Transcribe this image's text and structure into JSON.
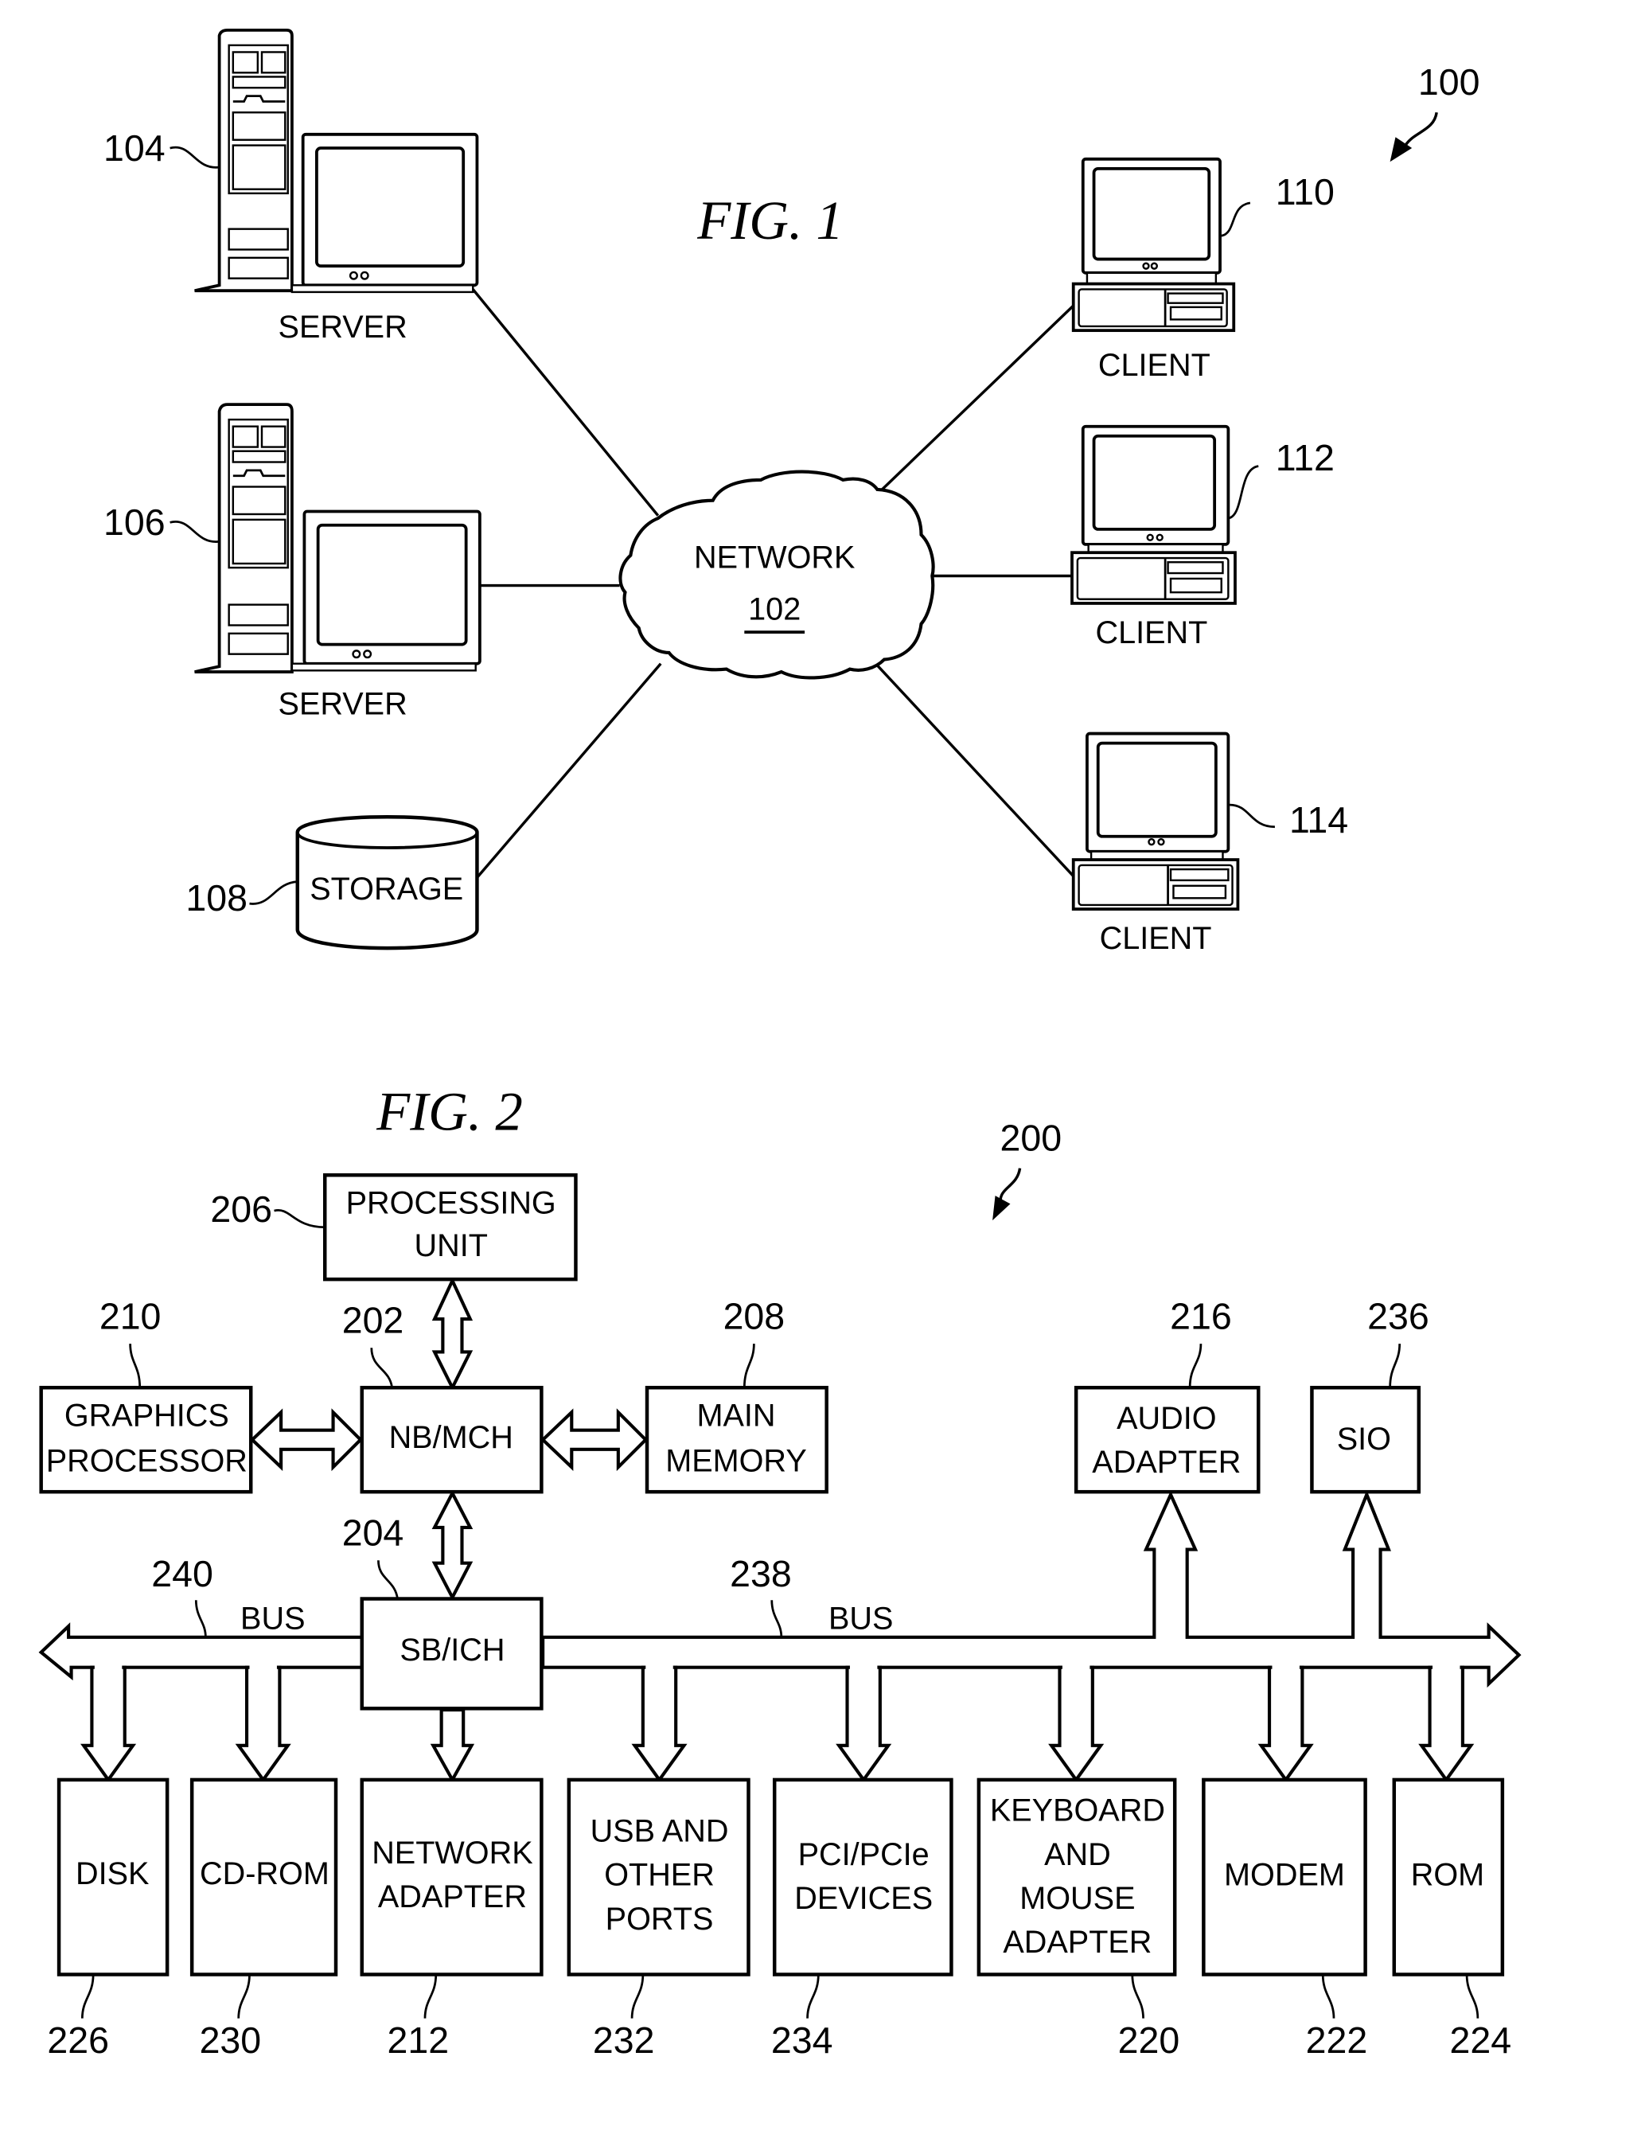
{
  "figure1": {
    "title": "FIG. 1",
    "ref": "100",
    "network": {
      "label": "NETWORK",
      "ref": "102"
    },
    "servers": [
      {
        "label": "SERVER",
        "ref": "104"
      },
      {
        "label": "SERVER",
        "ref": "106"
      }
    ],
    "storage": {
      "label": "STORAGE",
      "ref": "108"
    },
    "clients": [
      {
        "label": "CLIENT",
        "ref": "110"
      },
      {
        "label": "CLIENT",
        "ref": "112"
      },
      {
        "label": "CLIENT",
        "ref": "114"
      }
    ]
  },
  "figure2": {
    "title": "FIG. 2",
    "ref": "200",
    "processing_unit": {
      "lines": [
        "PROCESSING",
        "UNIT"
      ],
      "ref": "206"
    },
    "nb_mch": {
      "lines": [
        "NB/MCH"
      ],
      "ref": "202"
    },
    "graphics_processor": {
      "lines": [
        "GRAPHICS",
        "PROCESSOR"
      ],
      "ref": "210"
    },
    "main_memory": {
      "lines": [
        "MAIN",
        "MEMORY"
      ],
      "ref": "208"
    },
    "sb_ich": {
      "lines": [
        "SB/ICH"
      ],
      "ref": "204"
    },
    "audio_adapter": {
      "lines": [
        "AUDIO",
        "ADAPTER"
      ],
      "ref": "216"
    },
    "sio": {
      "lines": [
        "SIO"
      ],
      "ref": "236"
    },
    "bus_left": {
      "label": "BUS",
      "ref": "240"
    },
    "bus_right": {
      "label": "BUS",
      "ref": "238"
    },
    "devices": [
      {
        "lines": [
          "DISK"
        ],
        "ref": "226"
      },
      {
        "lines": [
          "CD-ROM"
        ],
        "ref": "230"
      },
      {
        "lines": [
          "NETWORK",
          "ADAPTER"
        ],
        "ref": "212"
      },
      {
        "lines": [
          "USB AND",
          "OTHER",
          "PORTS"
        ],
        "ref": "232"
      },
      {
        "lines": [
          "PCI/PCIe",
          "DEVICES"
        ],
        "ref": "234"
      },
      {
        "lines": [
          "KEYBOARD",
          "AND",
          "MOUSE",
          "ADAPTER"
        ],
        "ref": "220"
      },
      {
        "lines": [
          "MODEM"
        ],
        "ref": "222"
      },
      {
        "lines": [
          "ROM"
        ],
        "ref": "224"
      }
    ]
  }
}
